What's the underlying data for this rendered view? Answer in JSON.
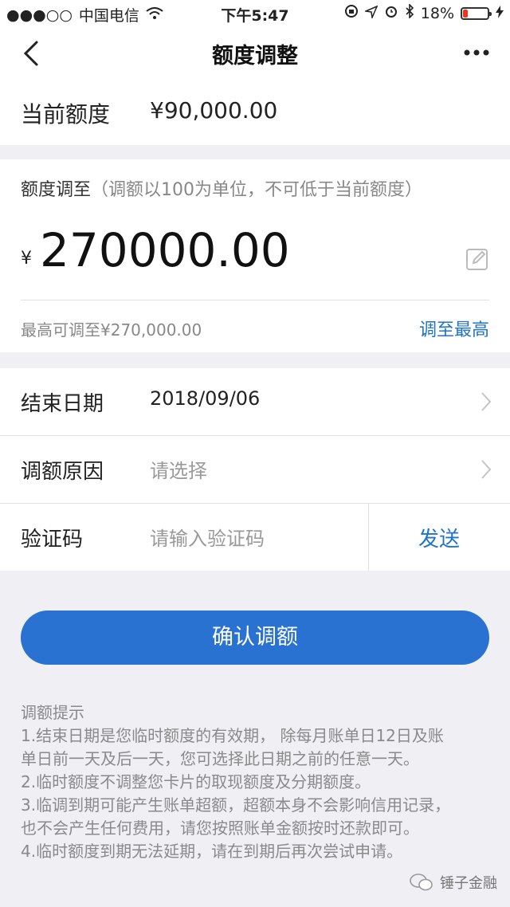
{
  "status_bar": {
    "signal": "●●●○○",
    "carrier": "中国电信",
    "time": "下午5:47",
    "battery_text": "18%",
    "battery_level": 0.18
  },
  "nav": {
    "title": "额度调整"
  },
  "current_limit": {
    "label": "当前额度",
    "value": "¥90,000.00"
  },
  "adjust": {
    "label": "额度调至",
    "hint": "（调额以100为单位，不可低于当前额度）",
    "currency": "¥",
    "amount": "270000.00",
    "max_text": "最高可调至¥270,000.00",
    "max_link": "调至最高"
  },
  "form": {
    "end_date_label": "结束日期",
    "end_date_value": "2018/09/06",
    "reason_label": "调额原因",
    "reason_placeholder": "请选择",
    "code_label": "验证码",
    "code_placeholder": "请输入验证码",
    "send_label": "发送"
  },
  "confirm_label": "确认调额",
  "tips": {
    "title": "调额提示",
    "items": [
      "1.结束日期是您临时额度的有效期， 除每月账单日12日及账",
      "单日前一天及后一天，您可选择此日期之前的任意一天。",
      "2.临时额度不调整您卡片的取现额度及分期额度。",
      "3.临调到期可能产生账单超额，超额本身不会影响信用记录，",
      "也不会产生任何费用，请您按照账单金额按时还款即可。",
      "4.临时额度到期无法延期，请在到期后再次尝试申请。"
    ]
  },
  "watermark": "锤子金融",
  "colors": {
    "accent": "#2a72d2",
    "link": "#1f73c8",
    "battery_low": "#e32"
  }
}
